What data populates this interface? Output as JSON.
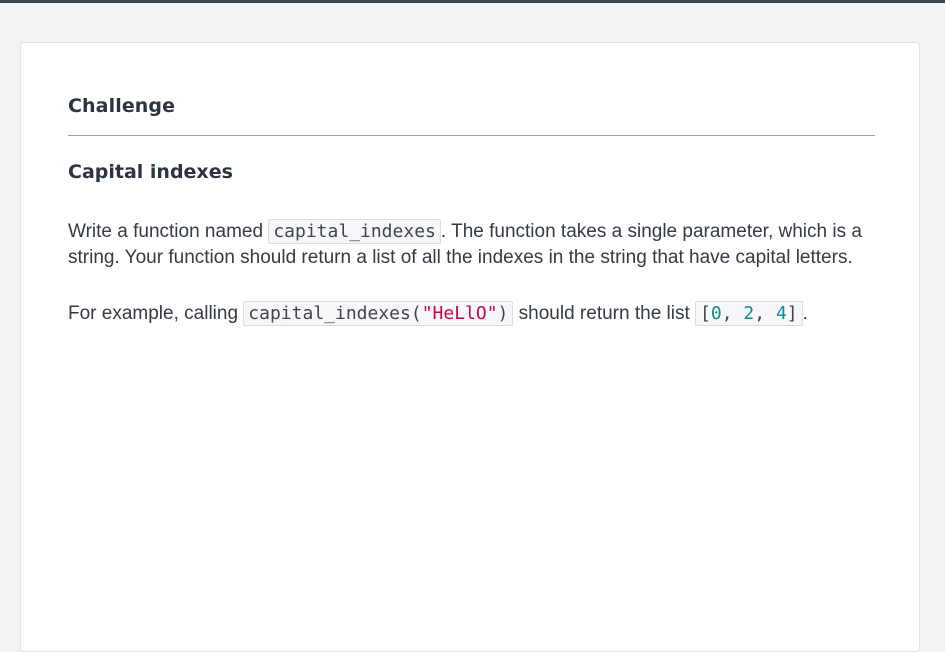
{
  "card": {
    "title": "Challenge",
    "section_title": "Capital indexes"
  },
  "paragraph1": {
    "pre": "Write a function named ",
    "code": "capital_indexes",
    "post": ". The function takes a single parameter, which is a string. Your function should return a list of all the indexes in the string that have capital letters."
  },
  "paragraph2": {
    "pre": "For example, calling ",
    "call_fn": "capital_indexes(",
    "call_arg": "\"HeLlO\"",
    "call_close": ")",
    "mid": " should return the list ",
    "list_open": "[",
    "n0": "0",
    "sep1": ", ",
    "n1": "2",
    "sep2": ", ",
    "n2": "4",
    "list_close": "]",
    "post": "."
  },
  "colors": {
    "string": "#c5064f",
    "number": "#0b8d91",
    "heading": "#2b3440"
  }
}
